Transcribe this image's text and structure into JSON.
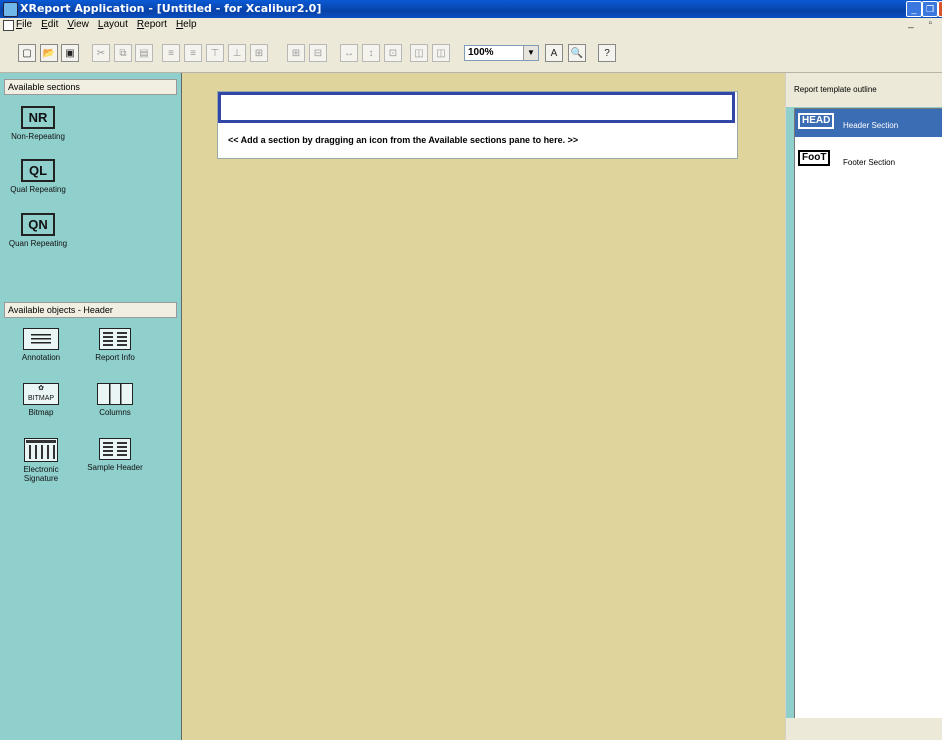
{
  "window": {
    "title": "XReport Application - [Untitled  - for Xcalibur2.0]",
    "controls": [
      "minimize",
      "restore",
      "close"
    ]
  },
  "menu": {
    "items": [
      "File",
      "Edit",
      "View",
      "Layout",
      "Report",
      "Help"
    ],
    "mdi_controls": "_ ▫"
  },
  "toolbar": {
    "zoom_value": "100%",
    "buttons": [
      {
        "name": "new-icon",
        "glyph": "▢",
        "enabled": true
      },
      {
        "name": "open-icon",
        "glyph": "📂",
        "enabled": true
      },
      {
        "name": "save-icon",
        "glyph": "▣",
        "enabled": true
      },
      {
        "name": "cut-icon",
        "glyph": "✂",
        "enabled": false
      },
      {
        "name": "copy-icon",
        "glyph": "⧉",
        "enabled": false
      },
      {
        "name": "paste-icon",
        "glyph": "▤",
        "enabled": false
      },
      {
        "name": "align-left-icon",
        "glyph": "≡",
        "enabled": false
      },
      {
        "name": "align-right-icon",
        "glyph": "≡",
        "enabled": false
      },
      {
        "name": "align-top-icon",
        "glyph": "⊤",
        "enabled": false
      },
      {
        "name": "align-bottom-icon",
        "glyph": "⊥",
        "enabled": false
      },
      {
        "name": "distribute-icon",
        "glyph": "⊞",
        "enabled": false
      },
      {
        "name": "group-icon",
        "glyph": "⊞",
        "enabled": false
      },
      {
        "name": "ungroup-icon",
        "glyph": "⊟",
        "enabled": false
      },
      {
        "name": "same-width-icon",
        "glyph": "↔",
        "enabled": false
      },
      {
        "name": "same-height-icon",
        "glyph": "↕",
        "enabled": false
      },
      {
        "name": "same-size-icon",
        "glyph": "⊡",
        "enabled": false
      },
      {
        "name": "bring-front-icon",
        "glyph": "◫",
        "enabled": false
      },
      {
        "name": "send-back-icon",
        "glyph": "◫",
        "enabled": false
      },
      {
        "name": "font-icon",
        "glyph": "A",
        "enabled": true
      },
      {
        "name": "print-preview-icon",
        "glyph": "🔍",
        "enabled": true
      },
      {
        "name": "help-icon",
        "glyph": "?",
        "enabled": true
      }
    ]
  },
  "left": {
    "sections_header": "Available sections",
    "sections": [
      {
        "label": "Non-Repeating",
        "icon": "NR"
      },
      {
        "label": "Qual Repeating",
        "icon": "QL"
      },
      {
        "label": "Quan Repeating",
        "icon": "QN"
      }
    ],
    "objects_header": "Available objects - Header",
    "objects": [
      {
        "label": "Annotation",
        "icon": "annotation-icon"
      },
      {
        "label": "Report Info",
        "icon": "report-info-icon"
      },
      {
        "label": "Bitmap",
        "icon": "bitmap-icon",
        "icon_text": "BITMAP"
      },
      {
        "label": "Columns",
        "icon": "columns-icon"
      },
      {
        "label": "Electronic Signature",
        "icon": "electronic-signature-icon"
      },
      {
        "label": "Sample Header",
        "icon": "sample-header-icon"
      }
    ]
  },
  "canvas": {
    "hint": "<< Add a section by dragging an icon from the Available sections pane to here. >>"
  },
  "right": {
    "header": "Report template outline",
    "outline": [
      {
        "tag": "HEAD",
        "label": "Header Section",
        "selected": true
      },
      {
        "tag": "FooT",
        "label": "Footer Section",
        "selected": false
      }
    ]
  },
  "colors": {
    "pane": "#8fcfcc",
    "canvas": "#dfd59c",
    "selection": "#3b6db5",
    "section_border": "#3246a8"
  }
}
